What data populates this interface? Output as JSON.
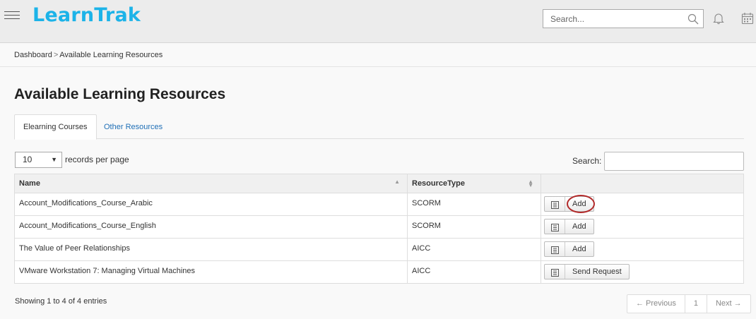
{
  "app": {
    "logo": "LearnTrak"
  },
  "header": {
    "search_placeholder": "Search..."
  },
  "breadcrumb": {
    "home": "Dashboard",
    "separator": ">",
    "current": "Available Learning Resources"
  },
  "page": {
    "title": "Available Learning Resources"
  },
  "tabs": [
    {
      "label": "Elearning Courses",
      "active": true
    },
    {
      "label": "Other Resources",
      "active": false
    }
  ],
  "table_controls": {
    "page_length": "10",
    "page_length_label": "records per page",
    "search_label": "Search:"
  },
  "table": {
    "columns": [
      "Name",
      "ResourceType",
      ""
    ],
    "rows": [
      {
        "name": "Account_Modifications_Course_Arabic",
        "type": "SCORM",
        "action": "Add"
      },
      {
        "name": "Account_Modifications_Course_English",
        "type": "SCORM",
        "action": "Add"
      },
      {
        "name": "The Value of Peer Relationships",
        "type": "AICC",
        "action": "Add"
      },
      {
        "name": "VMware Workstation 7: Managing Virtual Machines",
        "type": "AICC",
        "action": "Send Request"
      }
    ]
  },
  "footer": {
    "info": "Showing 1 to 4 of 4 entries",
    "prev": "← Previous",
    "page": "1",
    "next": "Next →"
  },
  "colors": {
    "brand": "#1cb3e8",
    "link": "#1f6fb6",
    "highlight": "#b22a2a"
  }
}
